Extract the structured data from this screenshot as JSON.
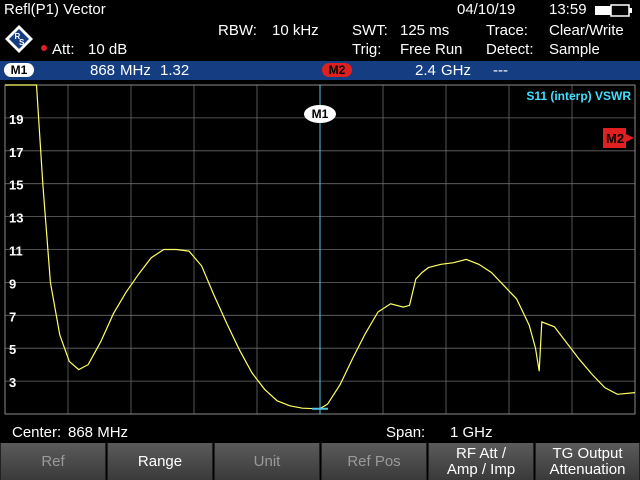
{
  "header": {
    "title": "Refl(P1) Vector",
    "date": "04/10/19",
    "time": "13:59"
  },
  "settings": {
    "att_label": "Att:",
    "att_value": "10 dB",
    "rbw_label": "RBW:",
    "rbw_value": "10 kHz",
    "swt_label": "SWT:",
    "swt_value": "125 ms",
    "trig_label": "Trig:",
    "trig_value": "Free Run",
    "trace_label": "Trace:",
    "trace_value": "Clear/Write",
    "detect_label": "Detect:",
    "detect_value": "Sample"
  },
  "markers": {
    "m1_label": "M1",
    "m1_freq_value": "868",
    "m1_freq_unit": "MHz",
    "m1_reading": "1.32",
    "m2_label": "M2",
    "m2_freq_value": "2.4",
    "m2_freq_unit": "GHz",
    "m2_reading": "---"
  },
  "plot": {
    "trace_label": "S11 (interp) VSWR",
    "marker1_label": "M1",
    "marker2_label": "M2"
  },
  "status": {
    "center_label": "Center:",
    "center_value": "868 MHz",
    "span_label": "Span:",
    "span_value": "1 GHz"
  },
  "softkeys": [
    {
      "line1": "Ref",
      "line2": "",
      "enabled": false
    },
    {
      "line1": "Range",
      "line2": "",
      "enabled": true
    },
    {
      "line1": "Unit",
      "line2": "",
      "enabled": false
    },
    {
      "line1": "Ref Pos",
      "line2": "",
      "enabled": false
    },
    {
      "line1": "RF Att /",
      "line2": "Amp / Imp",
      "enabled": true
    },
    {
      "line1": "TG Output",
      "line2": "Attenuation",
      "enabled": true
    }
  ],
  "colors": {
    "trace": "#ffff66",
    "marker_line": "#4fc8e8",
    "marker_bar": "#153d82",
    "m2_badge": "#e02020",
    "grid": "#6a6a6a",
    "trace_label": "#40e0ff"
  },
  "chart_data": {
    "type": "line",
    "title": "",
    "xlabel": "",
    "ylabel": "",
    "yticks": [
      "3",
      "5",
      "7",
      "9",
      "11",
      "13",
      "15",
      "17",
      "19"
    ],
    "ylim": [
      1,
      21
    ],
    "xlim": [
      368,
      1368
    ],
    "x_unit": "MHz",
    "grid": true,
    "series": [
      {
        "name": "S11 (interp) VSWR",
        "x": [
          368,
          388,
          398,
          408,
          418,
          428,
          440,
          455,
          470,
          485,
          500,
          520,
          540,
          560,
          580,
          600,
          620,
          640,
          660,
          680,
          700,
          720,
          740,
          760,
          780,
          800,
          820,
          840,
          860,
          868,
          880,
          900,
          920,
          940,
          960,
          980,
          1000,
          1010,
          1020,
          1030,
          1040,
          1060,
          1080,
          1100,
          1120,
          1140,
          1160,
          1180,
          1200,
          1210,
          1216,
          1220,
          1240,
          1260,
          1280,
          1300,
          1320,
          1340,
          1368
        ],
        "y": [
          21,
          21,
          21,
          21,
          21,
          15,
          9,
          5.8,
          4.2,
          3.7,
          4.0,
          5.4,
          7.1,
          8.4,
          9.5,
          10.5,
          11.0,
          11.0,
          10.9,
          10.0,
          8.2,
          6.5,
          4.9,
          3.5,
          2.5,
          1.8,
          1.5,
          1.35,
          1.32,
          1.32,
          1.6,
          2.8,
          4.4,
          5.9,
          7.2,
          7.7,
          7.5,
          7.6,
          9.2,
          9.6,
          9.9,
          10.1,
          10.2,
          10.4,
          10.1,
          9.6,
          8.8,
          8.0,
          6.4,
          5.0,
          3.6,
          6.6,
          6.3,
          5.3,
          4.3,
          3.4,
          2.6,
          2.2,
          2.3
        ]
      }
    ]
  }
}
